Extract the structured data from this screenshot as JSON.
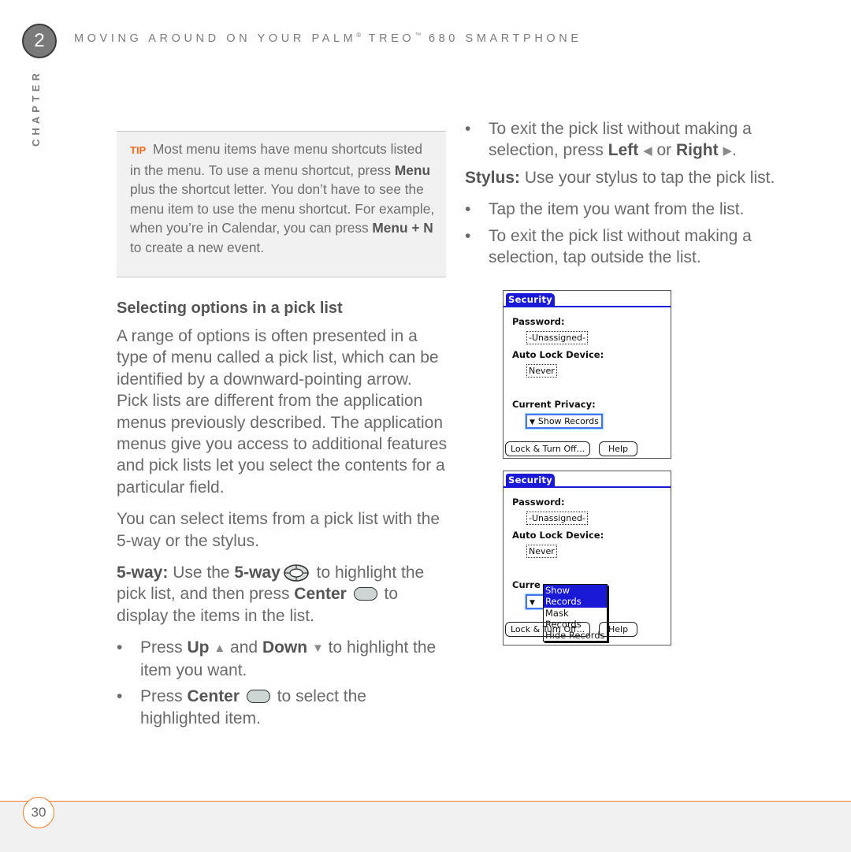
{
  "header": {
    "chapter_number": "2",
    "running_head_part1": "MOVING AROUND ON YOUR PALM",
    "reg_mark": "®",
    "running_head_part2": " TREO",
    "tm_mark": "™",
    "running_head_part3": " 680 SMARTPHONE",
    "chapter_label": "CHAPTER"
  },
  "tip": {
    "label": "TIP",
    "t1": " Most menu items have menu shortcuts listed in the menu. To use a menu shortcut, press ",
    "b1": "Menu",
    "t2": " plus the shortcut letter. You don’t have to see the menu item to use the menu shortcut. For example, when you’re in Calendar, you can press ",
    "b2": "Menu + N",
    "t3": " to create a new event."
  },
  "left": {
    "heading": "Selecting options in a pick list",
    "para1": "A range of options is often presented in a type of menu called a pick list, which can be identified by a downward-pointing arrow. Pick lists are different from the application menus previously described. The application menus give you access to additional features and pick lists let you select the contents for a particular field.",
    "para2": "You can select items from a pick list with the 5-way or the stylus.",
    "fiveway": {
      "lead": "5-way:",
      "t1": " Use the ",
      "b1": "5-way",
      "t2": " to highlight the pick list, and then press ",
      "b2": "Center",
      "t3": " to display the items in the list."
    },
    "bullets": [
      {
        "t1": "Press ",
        "b1": "Up",
        "t2": " and ",
        "b2": "Down",
        "t3": " to highlight the item you want."
      },
      {
        "t1": "Press ",
        "b1": "Center",
        "t2": " to select the highlighted item."
      }
    ]
  },
  "right": {
    "bullet_exit_5way": {
      "t1": "To exit the pick list without making a selection, press ",
      "b1": "Left",
      "t2": " or ",
      "b2": "Right",
      "t3": "."
    },
    "stylus": {
      "lead": "Stylus:",
      "text": " Use your stylus to tap the pick list."
    },
    "bullets": [
      "Tap the item you want from the list.",
      "To exit the pick list without making a selection, tap outside the list."
    ]
  },
  "palm_screens": [
    {
      "tab": "Security",
      "password_label": "Password:",
      "password_value": "-Unassigned-",
      "autolock_label": "Auto Lock Device:",
      "autolock_value": "Never",
      "privacy_label": "Current Privacy:",
      "privacy_value": "Show Records",
      "btn_lock": "Lock & Turn Off...",
      "btn_help": "Help"
    },
    {
      "tab": "Security",
      "password_label": "Password:",
      "password_value": "-Unassigned-",
      "autolock_label": "Auto Lock Device:",
      "autolock_value": "Never",
      "privacy_label_partial": "Curre",
      "popup_options": [
        "Show Records",
        "Mask Records",
        "Hide Records"
      ],
      "popup_selected": "Show Records",
      "btn_lock": "Lock & Turn Off...",
      "btn_help": "Help"
    }
  ],
  "bullet_char": "•",
  "glyphs": {
    "up": "▲",
    "down": "▼",
    "left": "◀",
    "right": "▶",
    "picker_arrow": "▼"
  },
  "footer": {
    "page_number": "30"
  },
  "colors": {
    "accent_orange": "#f07c2a",
    "tip_orange": "#f26b1d",
    "palm_blue": "#1a1ad6"
  }
}
